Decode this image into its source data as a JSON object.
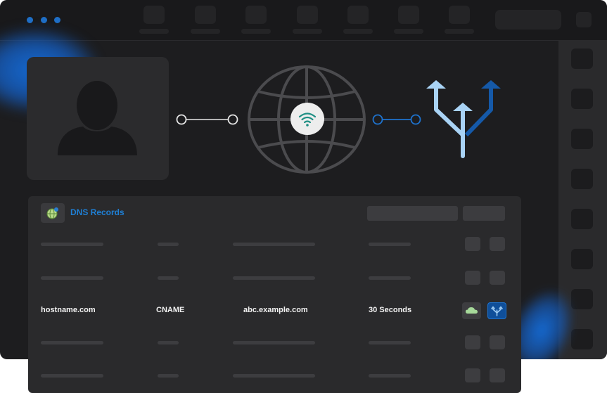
{
  "colors": {
    "accent": "#1f7fd4",
    "window_bg": "#1d1d1f",
    "panel_bg": "#2a2a2c",
    "glow": "#146edc"
  },
  "icons": {
    "avatar": "user-silhouette-icon",
    "globe": "globe-icon",
    "wifi": "wifi-icon",
    "fork": "fork-arrows-icon",
    "dns": "dns-globe-icon",
    "cloud": "cloud-icon",
    "route": "fork-icon"
  },
  "dns": {
    "title": "DNS Records",
    "record": {
      "hostname": "hostname.com",
      "type": "CNAME",
      "value": "abc.example.com",
      "ttl": "30 Seconds"
    }
  }
}
